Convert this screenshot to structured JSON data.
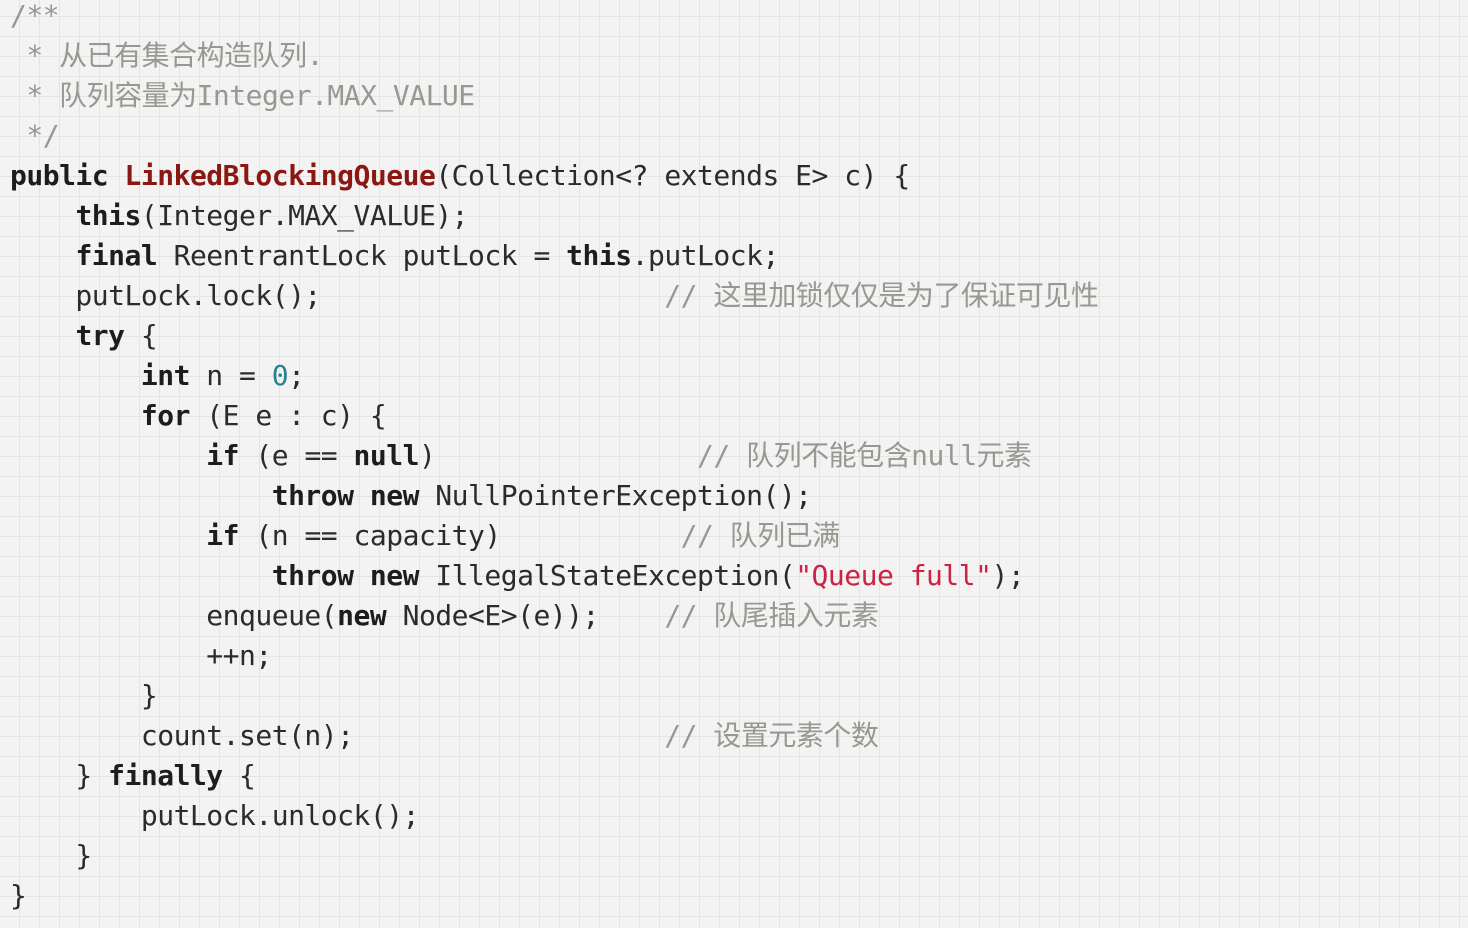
{
  "code": {
    "language": "java",
    "lines": [
      [
        {
          "t": "cmt",
          "v": "/**"
        }
      ],
      [
        {
          "t": "cmt",
          "v": " * 从已有集合构造队列."
        }
      ],
      [
        {
          "t": "cmt",
          "v": " * 队列容量为Integer.MAX_VALUE"
        }
      ],
      [
        {
          "t": "cmt",
          "v": " */"
        }
      ],
      [
        {
          "t": "kw",
          "v": "public"
        },
        {
          "t": "p",
          "v": " "
        },
        {
          "t": "fn",
          "v": "LinkedBlockingQueue"
        },
        {
          "t": "p",
          "v": "(Collection<? extends E> c) {"
        }
      ],
      [
        {
          "t": "p",
          "v": "    "
        },
        {
          "t": "kw",
          "v": "this"
        },
        {
          "t": "p",
          "v": "(Integer.MAX_VALUE);"
        }
      ],
      [
        {
          "t": "p",
          "v": "    "
        },
        {
          "t": "kw",
          "v": "final"
        },
        {
          "t": "p",
          "v": " ReentrantLock putLock = "
        },
        {
          "t": "kw",
          "v": "this"
        },
        {
          "t": "p",
          "v": ".putLock;"
        }
      ],
      [
        {
          "t": "p",
          "v": "    putLock.lock();                     "
        },
        {
          "t": "cmt",
          "v": "// 这里加锁仅仅是为了保证可见性"
        }
      ],
      [
        {
          "t": "p",
          "v": "    "
        },
        {
          "t": "kw",
          "v": "try"
        },
        {
          "t": "p",
          "v": " {"
        }
      ],
      [
        {
          "t": "p",
          "v": "        "
        },
        {
          "t": "kw",
          "v": "int"
        },
        {
          "t": "p",
          "v": " n = "
        },
        {
          "t": "num",
          "v": "0"
        },
        {
          "t": "p",
          "v": ";"
        }
      ],
      [
        {
          "t": "p",
          "v": "        "
        },
        {
          "t": "kw",
          "v": "for"
        },
        {
          "t": "p",
          "v": " (E e : c) {"
        }
      ],
      [
        {
          "t": "p",
          "v": "            "
        },
        {
          "t": "kw",
          "v": "if"
        },
        {
          "t": "p",
          "v": " (e == "
        },
        {
          "t": "kw",
          "v": "null"
        },
        {
          "t": "p",
          "v": ")                "
        },
        {
          "t": "cmt",
          "v": "// 队列不能包含null元素"
        }
      ],
      [
        {
          "t": "p",
          "v": "                "
        },
        {
          "t": "kw",
          "v": "throw"
        },
        {
          "t": "p",
          "v": " "
        },
        {
          "t": "kw",
          "v": "new"
        },
        {
          "t": "p",
          "v": " NullPointerException();"
        }
      ],
      [
        {
          "t": "p",
          "v": "            "
        },
        {
          "t": "kw",
          "v": "if"
        },
        {
          "t": "p",
          "v": " (n == capacity)           "
        },
        {
          "t": "cmt",
          "v": "// 队列已满"
        }
      ],
      [
        {
          "t": "p",
          "v": "                "
        },
        {
          "t": "kw",
          "v": "throw"
        },
        {
          "t": "p",
          "v": " "
        },
        {
          "t": "kw",
          "v": "new"
        },
        {
          "t": "p",
          "v": " IllegalStateException("
        },
        {
          "t": "str",
          "v": "\"Queue full\""
        },
        {
          "t": "p",
          "v": ");"
        }
      ],
      [
        {
          "t": "p",
          "v": "            enqueue("
        },
        {
          "t": "kw",
          "v": "new"
        },
        {
          "t": "p",
          "v": " Node<E>(e));    "
        },
        {
          "t": "cmt",
          "v": "// 队尾插入元素"
        }
      ],
      [
        {
          "t": "p",
          "v": "            ++n;"
        }
      ],
      [
        {
          "t": "p",
          "v": "        }"
        }
      ],
      [
        {
          "t": "p",
          "v": "        count.set(n);                   "
        },
        {
          "t": "cmt",
          "v": "// 设置元素个数"
        }
      ],
      [
        {
          "t": "p",
          "v": "    } "
        },
        {
          "t": "kw",
          "v": "finally"
        },
        {
          "t": "p",
          "v": " {"
        }
      ],
      [
        {
          "t": "p",
          "v": "        putLock.unlock();"
        }
      ],
      [
        {
          "t": "p",
          "v": "    }"
        }
      ],
      [
        {
          "t": "p",
          "v": "}"
        }
      ]
    ]
  }
}
